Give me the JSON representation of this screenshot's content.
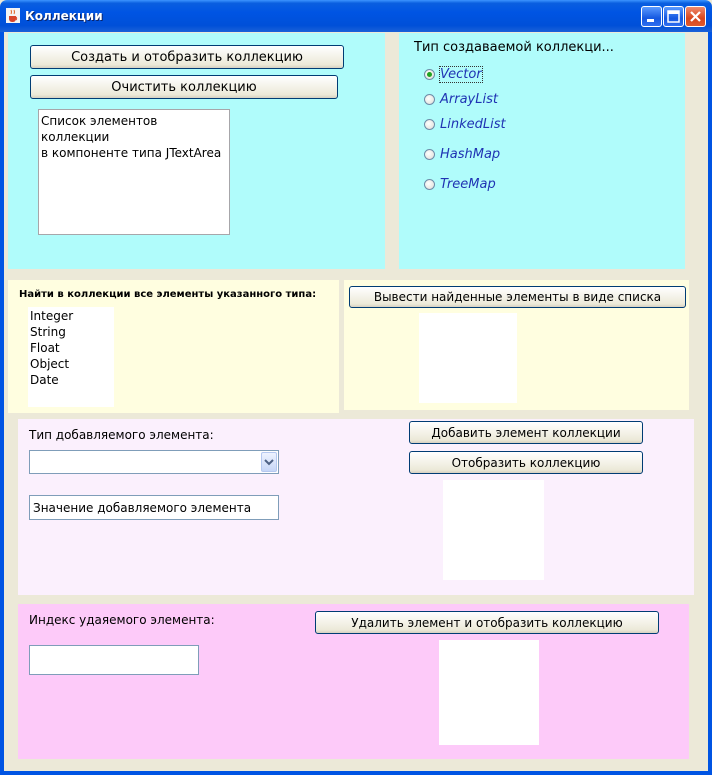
{
  "window": {
    "title": "Коллекции",
    "icon": "java-cup-icon",
    "buttons": [
      "minimize-icon",
      "maximize-icon",
      "close-icon"
    ]
  },
  "top_left": {
    "create_button": "Создать и отобразить коллекцию",
    "clear_button": "Очистить коллекцию",
    "textarea_line1": "Список элементов коллекции",
    "textarea_line2": "в компоненте типа JTextArea"
  },
  "top_right": {
    "heading": "Тип создаваемой коллекци...",
    "options": [
      {
        "label": "Vector",
        "selected": true
      },
      {
        "label": "ArrayList",
        "selected": false
      },
      {
        "label": "LinkedList",
        "selected": false
      },
      {
        "label": "HashMap",
        "selected": false
      },
      {
        "label": "TreeMap",
        "selected": false
      }
    ]
  },
  "find": {
    "heading": "Найти в коллекции все элементы указанного типа:",
    "types": [
      "Integer",
      "String",
      "Float",
      "Object",
      "Date"
    ],
    "output_button": "Вывести найденные элементы в виде списка"
  },
  "add": {
    "heading": "Тип добавляемого элемента:",
    "combo_value": "",
    "value_placeholder": "Значение добавляемого элемента",
    "add_button": "Добавить элемент коллекции",
    "show_button": "Отобразить коллекцию"
  },
  "remove": {
    "heading": "Индекс удаяемого элемента:",
    "index_value": "",
    "remove_button": "Удалить элемент и отобразить коллекцию"
  },
  "colors": {
    "cyan_panel": "#b0fcfb",
    "yellow_panel": "#fffee0",
    "lavender_panel": "#fbf0fd",
    "pink_panel": "#fdcaf9"
  }
}
